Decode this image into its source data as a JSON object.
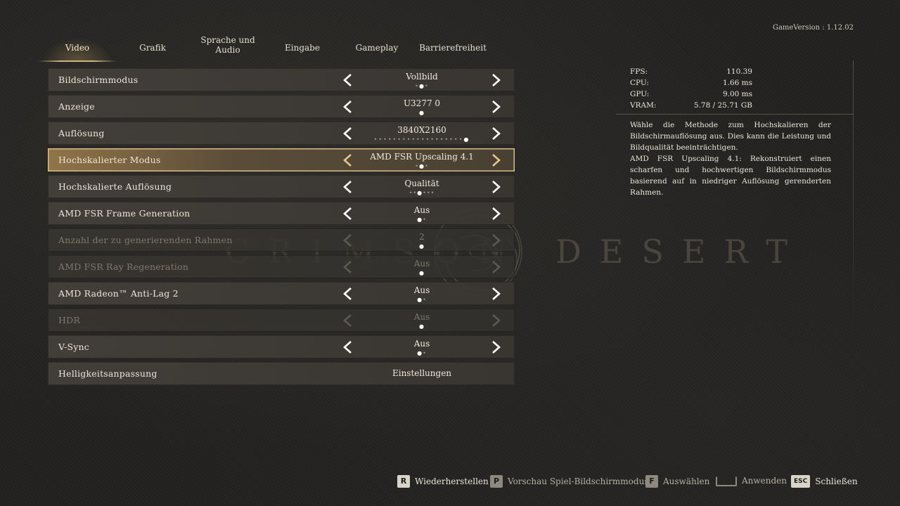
{
  "game_version": "GameVersion : 1.12.02",
  "tabs": [
    {
      "label": "Video"
    },
    {
      "label": "Grafik"
    },
    {
      "label": "Sprache und Audio"
    },
    {
      "label": "Eingabe"
    },
    {
      "label": "Gameplay"
    },
    {
      "label": "Barrierefreiheit"
    }
  ],
  "settings": [
    {
      "label": "Bildschirmmodus",
      "value": "Vollbild",
      "options_count": 3,
      "selected_index": 1
    },
    {
      "label": "Anzeige",
      "value": "U3277  0",
      "options_count": 1,
      "selected_index": 0
    },
    {
      "label": "Auflösung",
      "value": "3840X2160",
      "options_count": 20,
      "selected_index": 19
    },
    {
      "label": "Hochskalierter Modus",
      "value": "AMD FSR Upscaling 4.1",
      "options_count": 3,
      "selected_index": 1
    },
    {
      "label": "Hochskalierte Auflösung",
      "value": "Qualität",
      "options_count": 6,
      "selected_index": 2
    },
    {
      "label": "AMD FSR Frame Generation",
      "value": "Aus",
      "options_count": 2,
      "selected_index": 0
    },
    {
      "label": "Anzahl der zu generierenden Rahmen",
      "value": "2",
      "options_count": 1,
      "selected_index": 0
    },
    {
      "label": "AMD FSR Ray Regeneration",
      "value": "Aus",
      "options_count": 1,
      "selected_index": 0
    },
    {
      "label": "AMD Radeon™ Anti-Lag 2",
      "value": "Aus",
      "options_count": 2,
      "selected_index": 0
    },
    {
      "label": "HDR",
      "value": "Aus",
      "options_count": 1,
      "selected_index": 0
    },
    {
      "label": "V-Sync",
      "value": "Aus",
      "options_count": 2,
      "selected_index": 0
    },
    {
      "label": "Helligkeitsanpassung",
      "value": "Einstellungen"
    }
  ],
  "stats": [
    {
      "label": "FPS:",
      "value": "110.39"
    },
    {
      "label": "CPU:",
      "value": "1.66  ms"
    },
    {
      "label": "GPU:",
      "value": "9.00  ms"
    },
    {
      "label": "VRAM:",
      "value": "5.78  /  25.71  GB"
    }
  ],
  "description": {
    "line1": "Wähle die Methode zum Hochskalieren der Bildschirmauflösung aus. Dies kann die Leistung und Bildqualität beeinträchtigen.",
    "line2": "AMD FSR Upscaling 4.1: Rekonstruiert einen scharfen und hochwertigen Bildschirmmodus basierend auf in niedriger Auflösung gerenderten Rahmen."
  },
  "logo_text": {
    "left": "CRIMSON",
    "right": "DESERT"
  },
  "footer": [
    {
      "key": "R",
      "label": "Wiederherstellen"
    },
    {
      "key": "P",
      "label": "Vorschau Spiel-Bildschirmmodus"
    },
    {
      "key": "F",
      "label": "Auswählen"
    },
    {
      "key": "",
      "label": "Anwenden"
    },
    {
      "key": "ESC",
      "label": "Schließen"
    }
  ],
  "colors": {
    "accent": "#d9bd84",
    "background": "#222120",
    "row": "#423e38"
  }
}
